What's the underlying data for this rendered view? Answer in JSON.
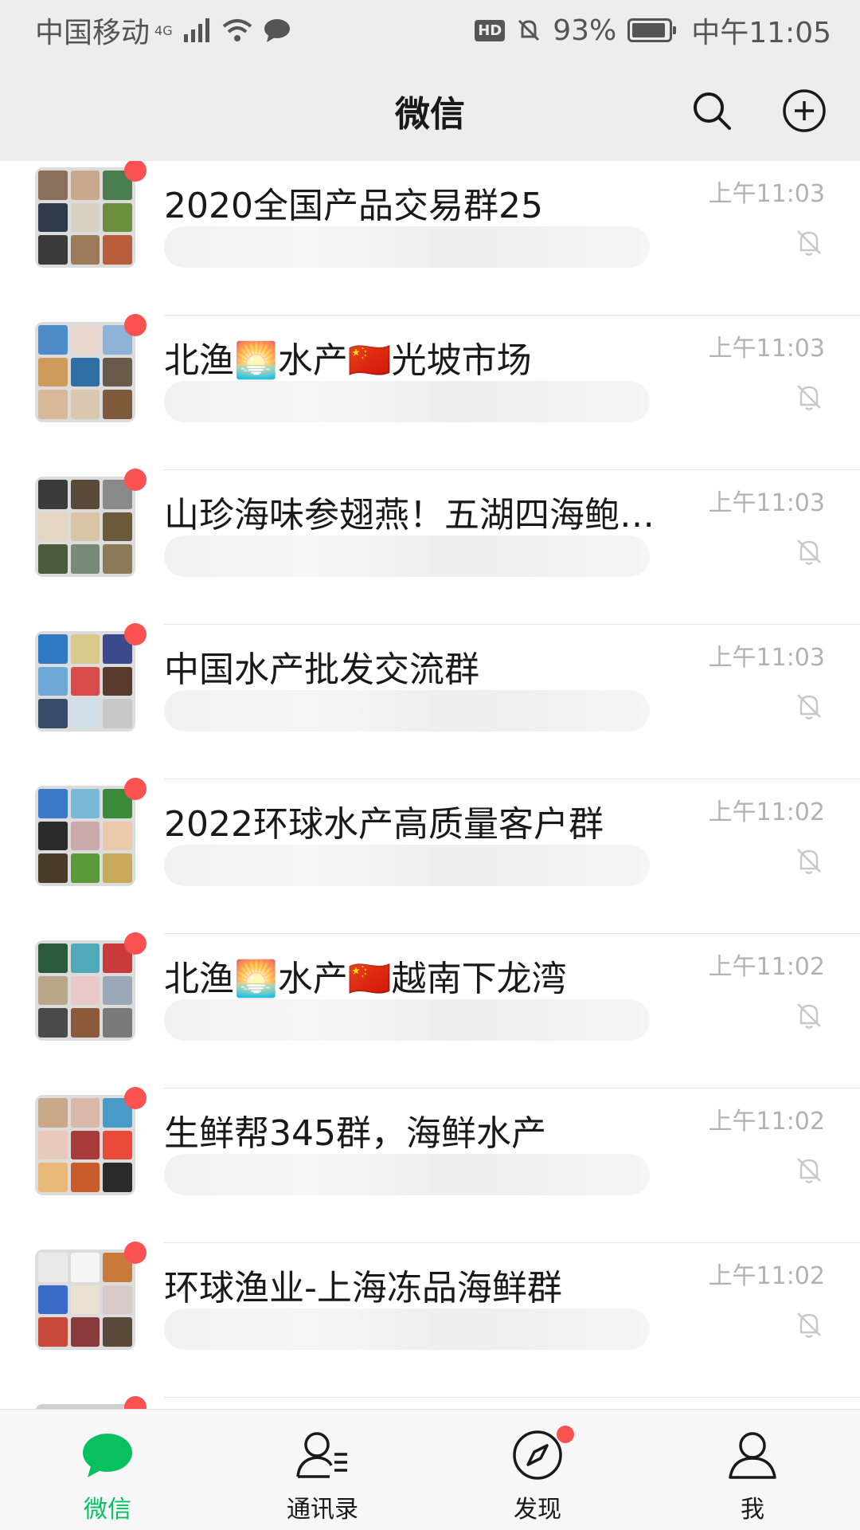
{
  "status_bar": {
    "carrier": "中国移动",
    "network": "4G",
    "hd_badge": "HD",
    "battery": "93%",
    "battery_level": 0.93,
    "time": "中午11:05"
  },
  "header": {
    "title": "微信",
    "search_icon": "search-icon",
    "add_icon": "plus-circle-icon"
  },
  "chats": [
    {
      "name": "2020全国产品交易群25",
      "time": "上午11:03",
      "muted": true,
      "unread_dot": true
    },
    {
      "name": "北渔🌅水产🇨🇳光坡市场",
      "time": "上午11:03",
      "muted": true,
      "unread_dot": true
    },
    {
      "name": "山珍海味参翅燕！五湖四海鲍…",
      "time": "上午11:03",
      "muted": true,
      "unread_dot": true
    },
    {
      "name": "中国水产批发交流群",
      "time": "上午11:03",
      "muted": true,
      "unread_dot": true
    },
    {
      "name": "2022环球水产高质量客户群",
      "time": "上午11:02",
      "muted": true,
      "unread_dot": true
    },
    {
      "name": "北渔🌅水产🇨🇳越南下龙湾",
      "time": "上午11:02",
      "muted": true,
      "unread_dot": true
    },
    {
      "name": "生鲜帮345群，海鲜水产",
      "time": "上午11:02",
      "muted": true,
      "unread_dot": true
    },
    {
      "name": "环球渔业-上海冻品海鲜群",
      "time": "上午11:02",
      "muted": true,
      "unread_dot": true
    }
  ],
  "tabs": [
    {
      "label": "微信",
      "icon": "chat-bubble-icon",
      "active": true
    },
    {
      "label": "通讯录",
      "icon": "contacts-icon",
      "active": false
    },
    {
      "label": "发现",
      "icon": "compass-icon",
      "active": false,
      "badge_dot": true
    },
    {
      "label": "我",
      "icon": "person-icon",
      "active": false
    }
  ],
  "colors": {
    "accent": "#07c160",
    "badge": "#fa5151",
    "bar_bg": "#ededed",
    "time_text": "#b2b2b2"
  }
}
